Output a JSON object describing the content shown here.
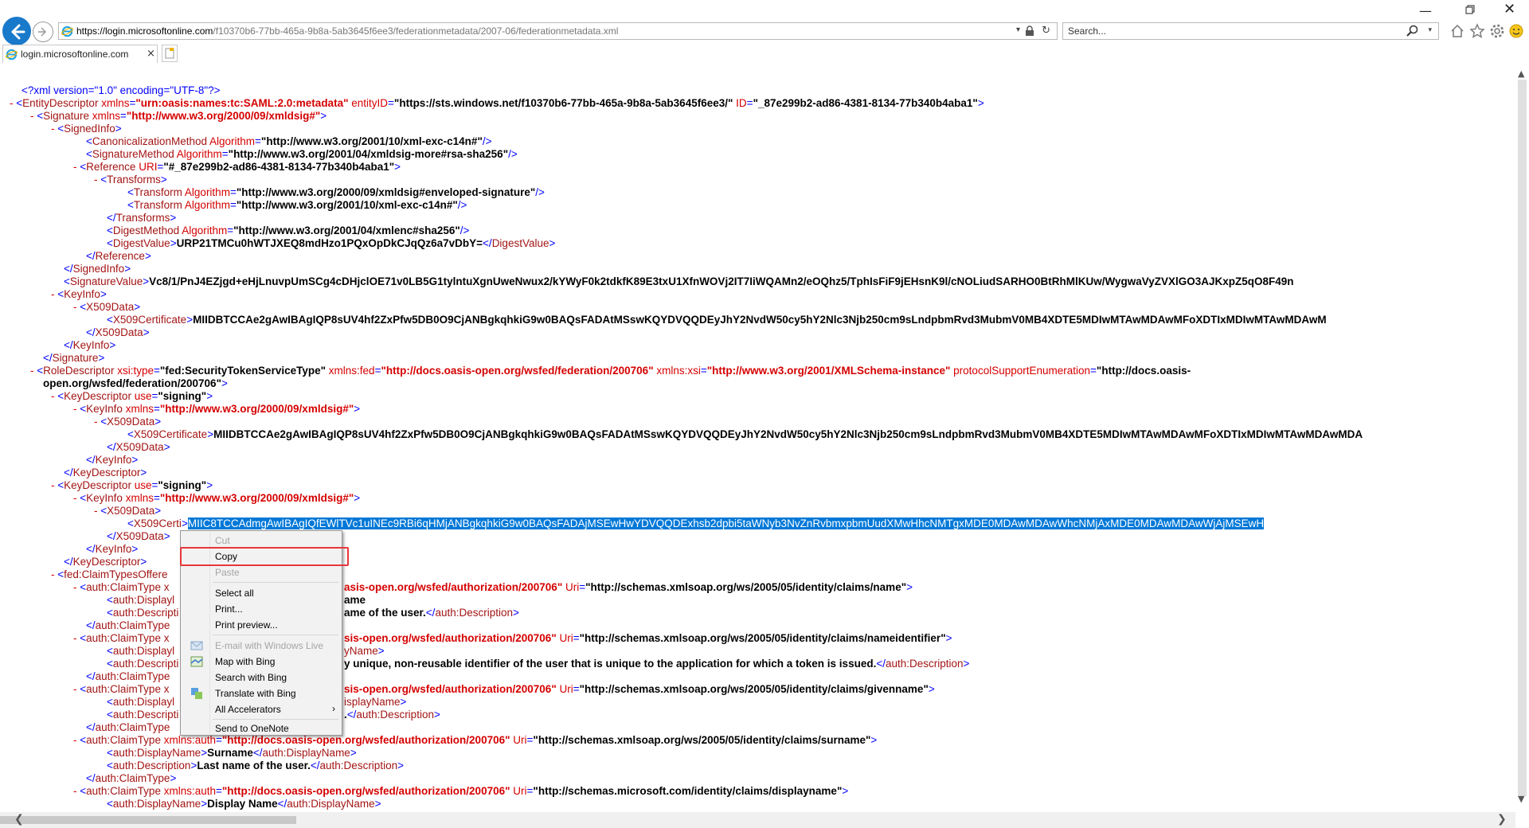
{
  "browser": {
    "url_host": "https://login.microsoftonline.com",
    "url_path": "/f10370b6-77bb-465a-9b8a-5ab3645f6ee3/federationmetadata/2007-06/federationmetadata.xml",
    "search_placeholder": "Search...",
    "tab_title": "login.microsoftonline.com",
    "tab_close": "×",
    "icons": [
      "back-arrow-icon",
      "forward-arrow-icon",
      "ie-logo-icon",
      "dropdown-arrow-icon",
      "lock-icon",
      "refresh-icon",
      "search-icon",
      "home-icon",
      "favorites-star-icon",
      "settings-gear-icon",
      "feedback-smiley-icon",
      "minimize-icon",
      "maximize-icon",
      "close-icon",
      "new-tab-icon"
    ],
    "window_min": "—",
    "window_close": "✕",
    "address_drop": "▾",
    "address_refresh": "↻",
    "search_drop": "▾"
  },
  "xml": {
    "l01": "<?xml version=\"1.0\" encoding=\"UTF-8\"?>",
    "entity_tag": "EntityDescriptor",
    "entity_xmlns_name": "xmlns",
    "entity_xmlns_val": "urn:oasis:names:tc:SAML:2.0:metadata",
    "entity_id_name": "entityID",
    "entity_id_val": "https://sts.windows.net/f10370b6-77bb-465a-9b8a-5ab3645f6ee3/",
    "entity_idattr_name": "ID",
    "entity_idattr_val": "_87e299b2-ad86-4381-8134-77b340b4aba1",
    "sig_tag": "Signature",
    "xmlns": "xmlns",
    "dsig_ns": "http://www.w3.org/2000/09/xmldsig#",
    "signedinfo": "SignedInfo",
    "canon": "CanonicalizationMethod",
    "algorithm": "Algorithm",
    "c14n": "http://www.w3.org/2001/10/xml-exc-c14n#",
    "sigmethod": "SignatureMethod",
    "rsa": "http://www.w3.org/2001/04/xmldsig-more#rsa-sha256",
    "reference": "Reference",
    "uri": "URI",
    "ref_uri": "#_87e299b2-ad86-4381-8134-77b340b4aba1",
    "transforms": "Transforms",
    "transform": "Transform",
    "env": "http://www.w3.org/2000/09/xmldsig#enveloped-signature",
    "digestmethod": "DigestMethod",
    "sha": "http://www.w3.org/2001/04/xmlenc#sha256",
    "digestvalue": "DigestValue",
    "digest": "URP21TMCu0hWTJXEQ8mdHzo1PQxOpDkCJqQz6a7vDbY=",
    "sigvalue": "SignatureValue",
    "sigval": "Vc8/1/PnJ4EZjgd+eHjLnuvpUmSCg4cDHjclOE71v0LB5G1tylntuXgnUweNwux2/kYWyF0k2tdkfK89E3txU1XfnWOVj2IT7IiWQAMn2/eOQhz5/TphIsFiF9jEHsnK9l/cNOLiudSARHO0BtRhMlKUw/WygwaVyZVXlGO3AJKxpZ5qO8F49n",
    "keyinfo": "KeyInfo",
    "x509data": "X509Data",
    "x509cert": "X509Certificate",
    "cert": "MIIDBTCCAe2gAwIBAgIQP8sUV4hf2ZxPfw5DB0O9CjANBgkqhkiG9w0BAQsFADAtMSswKQYDVQQDEyJhY2NvdW50cy5hY2Nlc3Njb250cm9sLndpbmRvd3MubmV0MB4XDTE5MDIwMTAwMDAwMFoXDTIxMDIwMTAwMDAwM",
    "cert2": "MIIDBTCCAe2gAwIBAgIQP8sUV4hf2ZxPfw5DB0O9CjANBgkqhkiG9w0BAQsFADAtMSswKQYDVQQDEyJhY2NvdW50cy5hY2Nlc3Njb250cm9sLndpbmRvd3MubmV0MB4XDTE5MDIwMTAwMDAwMFoXDTIxMDIwMTAwMDAwMDA",
    "cert_sel_prefix": "X509Certi",
    "cert_sel": "MIIC8TCCAdmgAwIBAgIQfEWlTVc1uINEc9RBi6qHMjANBgkqhkiG9w0BAQsFADAjMSEwHwYDVQQDExhsb2dpbi5taWNyb3NvZnRvbmxpbmUudXMwHhcNMTgxMDE0MDAwMDAwWhcNMjAxMDE0MDAwMDAwWjAjMSEwH",
    "roledesc": "RoleDescriptor",
    "xsitype": "xsi:type",
    "sts": "fed:SecurityTokenServiceType",
    "xmlnsfed": "xmlns:fed",
    "fedns": "http://docs.oasis-open.org/wsfed/federation/200706",
    "xmlnsxsi": "xmlns:xsi",
    "xsins": "http://www.w3.org/2001/XMLSchema-instance",
    "pse": "protocolSupportEnumeration",
    "pse_val1": "http://docs.oasis-",
    "pse_val2": "open.org/wsfed/federation/200706",
    "keydesc": "KeyDescriptor",
    "use": "use",
    "signing": "signing",
    "claimsoffered": "fed:ClaimTypesOffere",
    "claimtype": "auth:ClaimType",
    "claimtype_x": "auth:ClaimType x",
    "claimtype_close": "auth:ClaimType",
    "displayname": "auth:DisplayName",
    "displayname_cut": "auth:Displayl",
    "description": "auth:Description",
    "description_cut": "auth:Descripti",
    "xmlnsauth": "xmlns:auth",
    "authns": "http://docs.oasis-open.org/wsfed/authorization/200706",
    "authns_cut": "asis-open.org/wsfed/authorization/200706",
    "authns_cut2": "sis-open.org/wsfed/authorization/200706",
    "uri_attr": "Uri",
    "c_name": "http://schemas.xmlsoap.org/ws/2005/05/identity/claims/name",
    "c_nameid": "http://schemas.xmlsoap.org/ws/2005/05/identity/claims/nameidentifier",
    "c_given": "http://schemas.xmlsoap.org/ws/2005/05/identity/claims/givenname",
    "c_sur": "http://schemas.xmlsoap.org/ws/2005/05/identity/claims/surname",
    "c_disp": "http://schemas.microsoft.com/identity/claims/displayname",
    "d1_dn": "ame",
    "d1_desc": "ame of the user.",
    "d2_dn": "yName",
    "d2_desc": "y unique, non-reusable identifier of the user that is unique to the application for which a token is issued.",
    "d3_dn": "isplayName",
    "d3_desc": ".",
    "sur_dn": "Surname",
    "sur_desc": "Last name of the user.",
    "disp_dn": "Display Name",
    "minus": "-"
  },
  "context_menu": {
    "items": [
      {
        "label": "Cut",
        "enabled": false
      },
      {
        "label": "Copy",
        "enabled": true
      },
      {
        "label": "Paste",
        "enabled": false
      },
      {
        "label": "Select all",
        "enabled": true
      },
      {
        "label": "Print...",
        "enabled": true
      },
      {
        "label": "Print preview...",
        "enabled": true
      },
      {
        "label": "E-mail with Windows Live",
        "enabled": false
      },
      {
        "label": "Map with Bing",
        "enabled": true
      },
      {
        "label": "Search with Bing",
        "enabled": true
      },
      {
        "label": "Translate with Bing",
        "enabled": true
      },
      {
        "label": "All Accelerators",
        "enabled": true
      },
      {
        "label": "Send to OneNote",
        "enabled": true
      }
    ],
    "submenu_arrow": "›",
    "highlight_color": "#e8363a"
  },
  "scroll": {
    "up": "▲",
    "down": "▼",
    "left": "❮",
    "right": "❯"
  },
  "colors": {
    "selection": "#0078d7",
    "tag": "#a31515",
    "attr_name": "#d50000",
    "bracket": "#0000ff"
  }
}
